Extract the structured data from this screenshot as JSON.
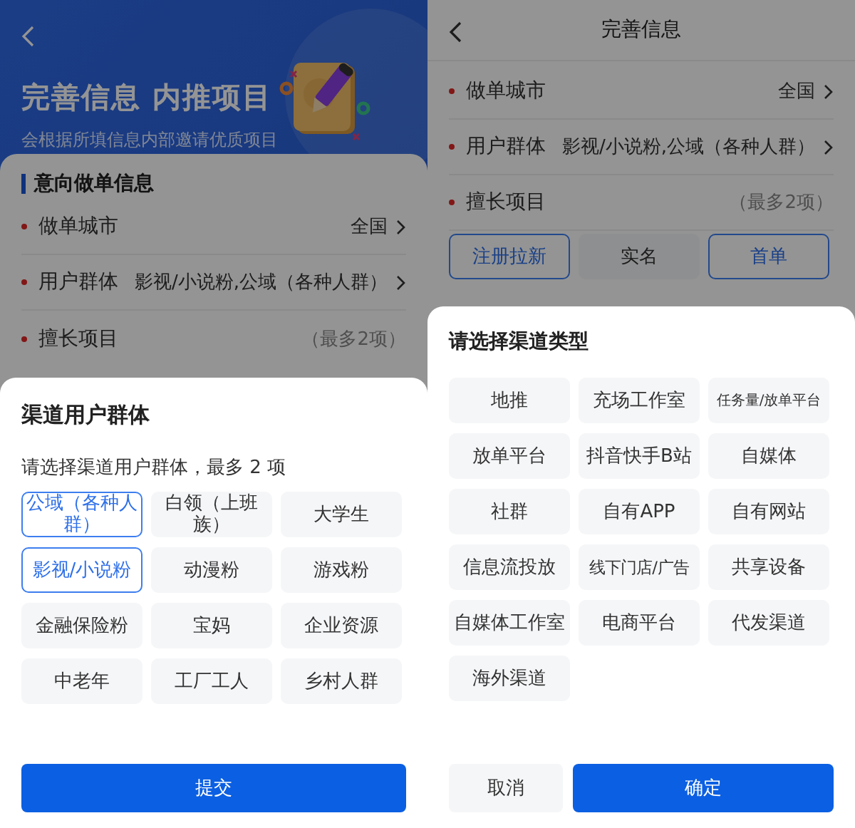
{
  "left_screen": {
    "header": {
      "title": "完善信息 内推项目",
      "subtitle": "会根据所填信息内部邀请优质项目"
    },
    "section_title": "意向做单信息",
    "fields": [
      {
        "kind": "select",
        "label": "做单城市",
        "value": "全国",
        "required": true
      },
      {
        "kind": "select",
        "label": "用户群体",
        "value": "影视/小说粉,公域（各种人群）",
        "required": true
      },
      {
        "kind": "hint",
        "label": "擅长项目",
        "value": "（最多2项）",
        "required": true
      }
    ],
    "sheet": {
      "title": "渠道用户群体",
      "hint": "请选择渠道用户群体，最多 2 项",
      "options": [
        {
          "label": "公域（各种人群）",
          "selected": true
        },
        {
          "label": "白领（上班族）",
          "selected": false
        },
        {
          "label": "大学生",
          "selected": false
        },
        {
          "label": "影视/小说粉",
          "selected": true
        },
        {
          "label": "动漫粉",
          "selected": false
        },
        {
          "label": "游戏粉",
          "selected": false
        },
        {
          "label": "金融保险粉",
          "selected": false
        },
        {
          "label": "宝妈",
          "selected": false
        },
        {
          "label": "企业资源",
          "selected": false
        },
        {
          "label": "中老年",
          "selected": false
        },
        {
          "label": "工厂工人",
          "selected": false
        },
        {
          "label": "乡村人群",
          "selected": false
        }
      ],
      "submit": "提交"
    }
  },
  "right_screen": {
    "nav_title": "完善信息",
    "fields": [
      {
        "kind": "select",
        "label": "做单城市",
        "value": "全国",
        "required": true
      },
      {
        "kind": "select",
        "label": "用户群体",
        "value": "影视/小说粉,公域（各种人群）",
        "required": true
      },
      {
        "kind": "hint",
        "label": "擅长项目",
        "value": "（最多2项）",
        "required": true
      }
    ],
    "skills": [
      {
        "label": "注册拉新",
        "selected": true
      },
      {
        "label": "实名",
        "selected": false
      },
      {
        "label": "首单",
        "selected": true
      }
    ],
    "sheet": {
      "title": "请选择渠道类型",
      "options": [
        {
          "label": "地推",
          "selected": false
        },
        {
          "label": "充场工作室",
          "selected": false
        },
        {
          "label": "任务量/放单平台",
          "selected": false
        },
        {
          "label": "放单平台",
          "selected": false
        },
        {
          "label": "抖音快手B站",
          "selected": false
        },
        {
          "label": "自媒体",
          "selected": false
        },
        {
          "label": "社群",
          "selected": false
        },
        {
          "label": "自有APP",
          "selected": false
        },
        {
          "label": "自有网站",
          "selected": false
        },
        {
          "label": "信息流投放",
          "selected": false
        },
        {
          "label": "线下门店/广告",
          "selected": false
        },
        {
          "label": "共享设备",
          "selected": false
        },
        {
          "label": "自媒体工作室",
          "selected": false
        },
        {
          "label": "电商平台",
          "selected": false
        },
        {
          "label": "代发渠道",
          "selected": false
        },
        {
          "label": "海外渠道",
          "selected": false
        }
      ],
      "cancel": "取消",
      "confirm": "确定"
    }
  }
}
